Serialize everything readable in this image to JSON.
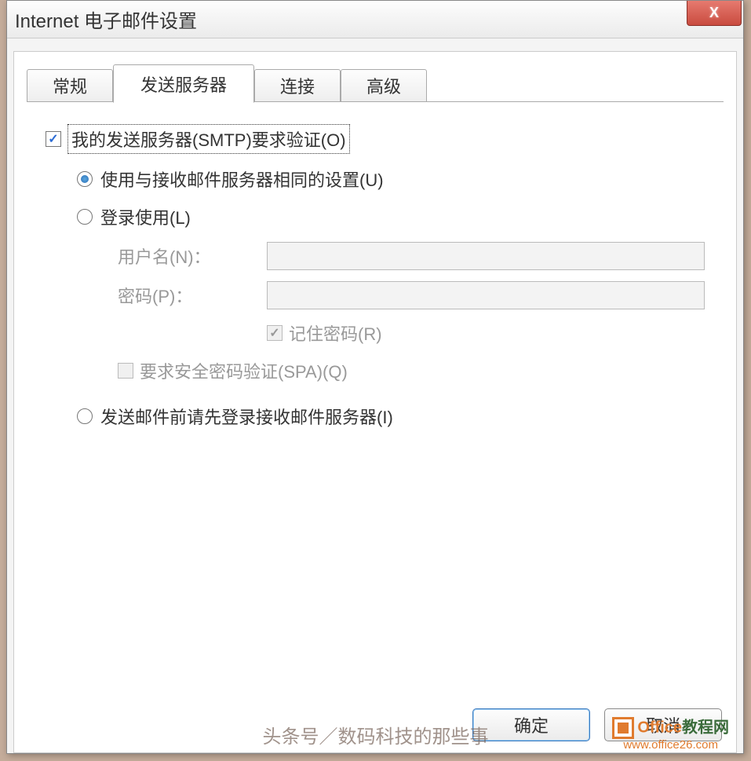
{
  "window": {
    "title": "Internet 电子邮件设置",
    "close": "X"
  },
  "tabs": {
    "general": "常规",
    "outgoing": "发送服务器",
    "connection": "连接",
    "advanced": "高级"
  },
  "form": {
    "smtp_auth": "我的发送服务器(SMTP)要求验证(O)",
    "use_same": "使用与接收邮件服务器相同的设置(U)",
    "login_using": "登录使用(L)",
    "username_label": "用户名(N)：",
    "password_label": "密码(P)：",
    "remember_password": "记住密码(R)",
    "require_spa": "要求安全密码验证(SPA)(Q)",
    "login_before_send": "发送邮件前请先登录接收邮件服务器(I)"
  },
  "buttons": {
    "ok": "确定",
    "cancel": "取消"
  },
  "watermark": {
    "main": "头条号／数码科技的那些事",
    "brand1": "Office",
    "brand2": "教程网",
    "url": "www.office26.com"
  }
}
